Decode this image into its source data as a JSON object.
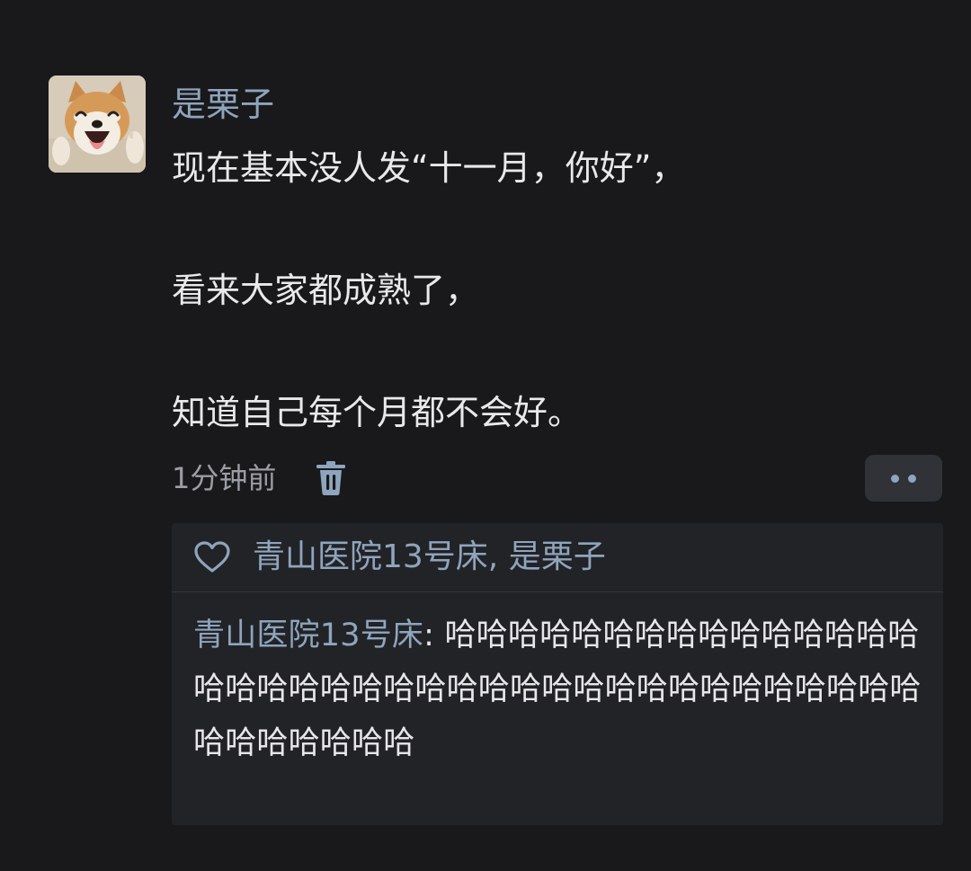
{
  "post": {
    "username": "是栗子",
    "lines": [
      "现在基本没人发“十一月，你好”，",
      "看来大家都成熟了，",
      "知道自己每个月都不会好。"
    ],
    "timestamp": "1分钟前",
    "icons": {
      "avatar": "shiba-dog-avatar",
      "delete": "trash-icon",
      "more": "more-dots-icon"
    }
  },
  "reply_box": {
    "likes_icon": "heart-icon",
    "likes_text": "青山医院13号床, 是栗子",
    "comment": {
      "author": "青山医院13号床",
      "separator": ": ",
      "text": "哈哈哈哈哈哈哈哈哈哈哈哈哈哈哈哈哈哈哈哈哈哈哈哈哈哈哈哈哈哈哈哈哈哈哈哈哈哈哈哈哈哈哈哈哈"
    }
  },
  "colors": {
    "background": "#19191b",
    "accent": "#8fa4bd",
    "text": "#e9e9eb",
    "muted": "#9c9ea4",
    "panel": "#222326"
  }
}
